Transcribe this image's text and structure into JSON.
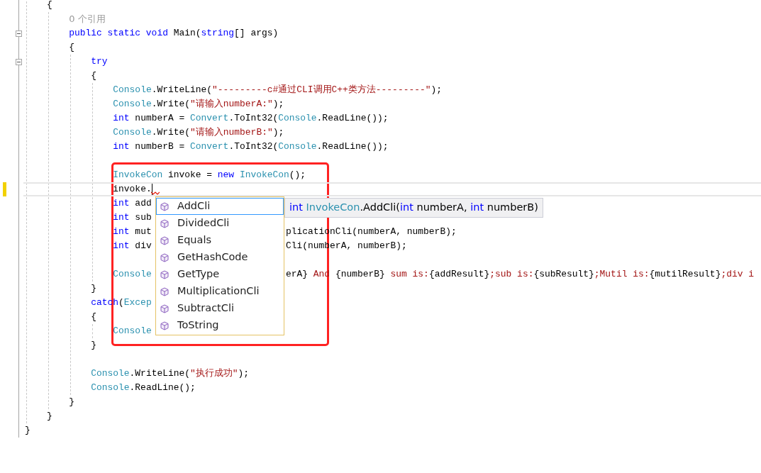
{
  "editor": {
    "lines": [
      {
        "kind": "block",
        "children": [
          {
            "kind": "code",
            "tokens": [
              {
                "kind": "plain",
                "text": "{"
              }
            ]
          },
          {
            "kind": "block",
            "children": [
              {
                "kind": "code",
                "tokens": [
                  {
                    "kind": "lens",
                    "text": "0 个引用"
                  }
                ]
              },
              {
                "kind": "code",
                "expanded": true,
                "tokens": [
                  {
                    "kind": "kw",
                    "text": "public static void"
                  },
                  {
                    "kind": "plain",
                    "text": " Main("
                  },
                  {
                    "kind": "kw",
                    "text": "string"
                  },
                  {
                    "kind": "plain",
                    "text": "[] args)"
                  }
                ]
              },
              {
                "kind": "code",
                "tokens": [
                  {
                    "kind": "plain",
                    "text": "{"
                  }
                ]
              },
              {
                "kind": "block",
                "children": [
                  {
                    "kind": "code",
                    "expanded": true,
                    "tokens": [
                      {
                        "kind": "kw",
                        "text": "try"
                      }
                    ]
                  },
                  {
                    "kind": "code",
                    "tokens": [
                      {
                        "kind": "plain",
                        "text": "{"
                      }
                    ]
                  },
                  {
                    "kind": "block",
                    "children": [
                      {
                        "kind": "code",
                        "tokens": [
                          {
                            "kind": "type",
                            "text": "Console"
                          },
                          {
                            "kind": "plain",
                            "text": ".WriteLine("
                          },
                          {
                            "kind": "str",
                            "text": "\"---------c#通过CLI调用C++类方法---------\""
                          },
                          {
                            "kind": "plain",
                            "text": ");"
                          }
                        ]
                      },
                      {
                        "kind": "code",
                        "tokens": [
                          {
                            "kind": "type",
                            "text": "Console"
                          },
                          {
                            "kind": "plain",
                            "text": ".Write("
                          },
                          {
                            "kind": "str",
                            "text": "\"请输入numberA:\""
                          },
                          {
                            "kind": "plain",
                            "text": ");"
                          }
                        ]
                      },
                      {
                        "kind": "code",
                        "tokens": [
                          {
                            "kind": "kw",
                            "text": "int"
                          },
                          {
                            "kind": "plain",
                            "text": " numberA = "
                          },
                          {
                            "kind": "type",
                            "text": "Convert"
                          },
                          {
                            "kind": "plain",
                            "text": ".ToInt32("
                          },
                          {
                            "kind": "type",
                            "text": "Console"
                          },
                          {
                            "kind": "plain",
                            "text": ".ReadLine());"
                          }
                        ]
                      },
                      {
                        "kind": "code",
                        "tokens": [
                          {
                            "kind": "type",
                            "text": "Console"
                          },
                          {
                            "kind": "plain",
                            "text": ".Write("
                          },
                          {
                            "kind": "str",
                            "text": "\"请输入numberB:\""
                          },
                          {
                            "kind": "plain",
                            "text": ");"
                          }
                        ]
                      },
                      {
                        "kind": "code",
                        "tokens": [
                          {
                            "kind": "kw",
                            "text": "int"
                          },
                          {
                            "kind": "plain",
                            "text": " numberB = "
                          },
                          {
                            "kind": "type",
                            "text": "Convert"
                          },
                          {
                            "kind": "plain",
                            "text": ".ToInt32("
                          },
                          {
                            "kind": "type",
                            "text": "Console"
                          },
                          {
                            "kind": "plain",
                            "text": ".ReadLine());"
                          }
                        ]
                      },
                      {
                        "kind": "blank"
                      },
                      {
                        "kind": "code",
                        "tokens": [
                          {
                            "kind": "type",
                            "text": "InvokeCon"
                          },
                          {
                            "kind": "plain",
                            "text": " invoke = "
                          },
                          {
                            "kind": "kw",
                            "text": "new"
                          },
                          {
                            "kind": "type",
                            "text": " InvokeCon"
                          },
                          {
                            "kind": "plain",
                            "text": "();"
                          }
                        ]
                      },
                      {
                        "kind": "code",
                        "current": true,
                        "changed": true,
                        "caret": true,
                        "squiggle": true,
                        "tokens": [
                          {
                            "kind": "plain",
                            "text": "invoke."
                          }
                        ]
                      },
                      {
                        "kind": "code",
                        "tokens": [
                          {
                            "kind": "kw",
                            "text": "int"
                          },
                          {
                            "kind": "plain",
                            "text": " add"
                          }
                        ]
                      },
                      {
                        "kind": "code",
                        "tokens": [
                          {
                            "kind": "kw",
                            "text": "int"
                          },
                          {
                            "kind": "plain",
                            "text": " sub"
                          }
                        ]
                      },
                      {
                        "kind": "code",
                        "tokens": [
                          {
                            "kind": "kw",
                            "text": "int"
                          },
                          {
                            "kind": "plain",
                            "text": " mut"
                          }
                        ],
                        "tokens_after_popup": [
                          {
                            "kind": "plain",
                            "text": "plicationCli(numberA, numberB);"
                          }
                        ]
                      },
                      {
                        "kind": "code",
                        "tokens": [
                          {
                            "kind": "kw",
                            "text": "int"
                          },
                          {
                            "kind": "plain",
                            "text": " div"
                          }
                        ],
                        "tokens_after_popup": [
                          {
                            "kind": "plain",
                            "text": "Cli(numberA, numberB);"
                          }
                        ]
                      },
                      {
                        "kind": "blank"
                      },
                      {
                        "kind": "code",
                        "tokens": [
                          {
                            "kind": "type",
                            "text": "Console"
                          }
                        ],
                        "tokens_after_popup": [
                          {
                            "kind": "plain",
                            "text": "erA}"
                          },
                          {
                            "kind": "str",
                            "text": " And "
                          },
                          {
                            "kind": "plain",
                            "text": "{numberB}"
                          },
                          {
                            "kind": "str",
                            "text": " sum is:"
                          },
                          {
                            "kind": "plain",
                            "text": "{addResult}"
                          },
                          {
                            "kind": "str",
                            "text": ";sub is:"
                          },
                          {
                            "kind": "plain",
                            "text": "{subResult}"
                          },
                          {
                            "kind": "str",
                            "text": ";Mutil is:"
                          },
                          {
                            "kind": "plain",
                            "text": "{mutilResult}"
                          },
                          {
                            "kind": "str",
                            "text": ";div i"
                          }
                        ]
                      }
                    ]
                  },
                  {
                    "kind": "code",
                    "tokens": [
                      {
                        "kind": "plain",
                        "text": "}"
                      }
                    ]
                  },
                  {
                    "kind": "code",
                    "tokens": [
                      {
                        "kind": "kw",
                        "text": "catch"
                      },
                      {
                        "kind": "plain",
                        "text": "("
                      },
                      {
                        "kind": "type",
                        "text": "Excep"
                      }
                    ]
                  },
                  {
                    "kind": "code",
                    "tokens": [
                      {
                        "kind": "plain",
                        "text": "{"
                      }
                    ]
                  },
                  {
                    "kind": "block",
                    "children": [
                      {
                        "kind": "code",
                        "tokens": [
                          {
                            "kind": "type",
                            "text": "Console"
                          }
                        ]
                      }
                    ]
                  },
                  {
                    "kind": "code",
                    "tokens": [
                      {
                        "kind": "plain",
                        "text": "}"
                      }
                    ]
                  },
                  {
                    "kind": "blank"
                  },
                  {
                    "kind": "code",
                    "tokens": [
                      {
                        "kind": "type",
                        "text": "Console"
                      },
                      {
                        "kind": "plain",
                        "text": ".WriteLine("
                      },
                      {
                        "kind": "str",
                        "text": "\"执行成功\""
                      },
                      {
                        "kind": "plain",
                        "text": ");"
                      }
                    ]
                  },
                  {
                    "kind": "code",
                    "tokens": [
                      {
                        "kind": "type",
                        "text": "Console"
                      },
                      {
                        "kind": "plain",
                        "text": ".ReadLine();"
                      }
                    ]
                  }
                ]
              },
              {
                "kind": "code",
                "tokens": [
                  {
                    "kind": "plain",
                    "text": "}"
                  }
                ]
              }
            ]
          },
          {
            "kind": "code",
            "tokens": [
              {
                "kind": "plain",
                "text": "}"
              }
            ]
          }
        ]
      },
      {
        "kind": "code",
        "tokens": [
          {
            "kind": "plain",
            "text": "}"
          }
        ]
      }
    ]
  },
  "completion": {
    "items": [
      {
        "label": "AddCli",
        "selected": true
      },
      {
        "label": "DividedCli",
        "selected": false
      },
      {
        "label": "Equals",
        "selected": false
      },
      {
        "label": "GetHashCode",
        "selected": false
      },
      {
        "label": "GetType",
        "selected": false
      },
      {
        "label": "MultiplicationCli",
        "selected": false
      },
      {
        "label": "SubtractCli",
        "selected": false
      },
      {
        "label": "ToString",
        "selected": false
      }
    ],
    "tooltip": [
      {
        "kind": "kw",
        "text": "int"
      },
      {
        "kind": "type",
        "text": " InvokeCon"
      },
      {
        "kind": "plain",
        "text": ".AddCli("
      },
      {
        "kind": "kw",
        "text": "int"
      },
      {
        "kind": "plain",
        "text": " numberA, "
      },
      {
        "kind": "kw",
        "text": "int"
      },
      {
        "kind": "plain",
        "text": " numberB)"
      }
    ]
  }
}
